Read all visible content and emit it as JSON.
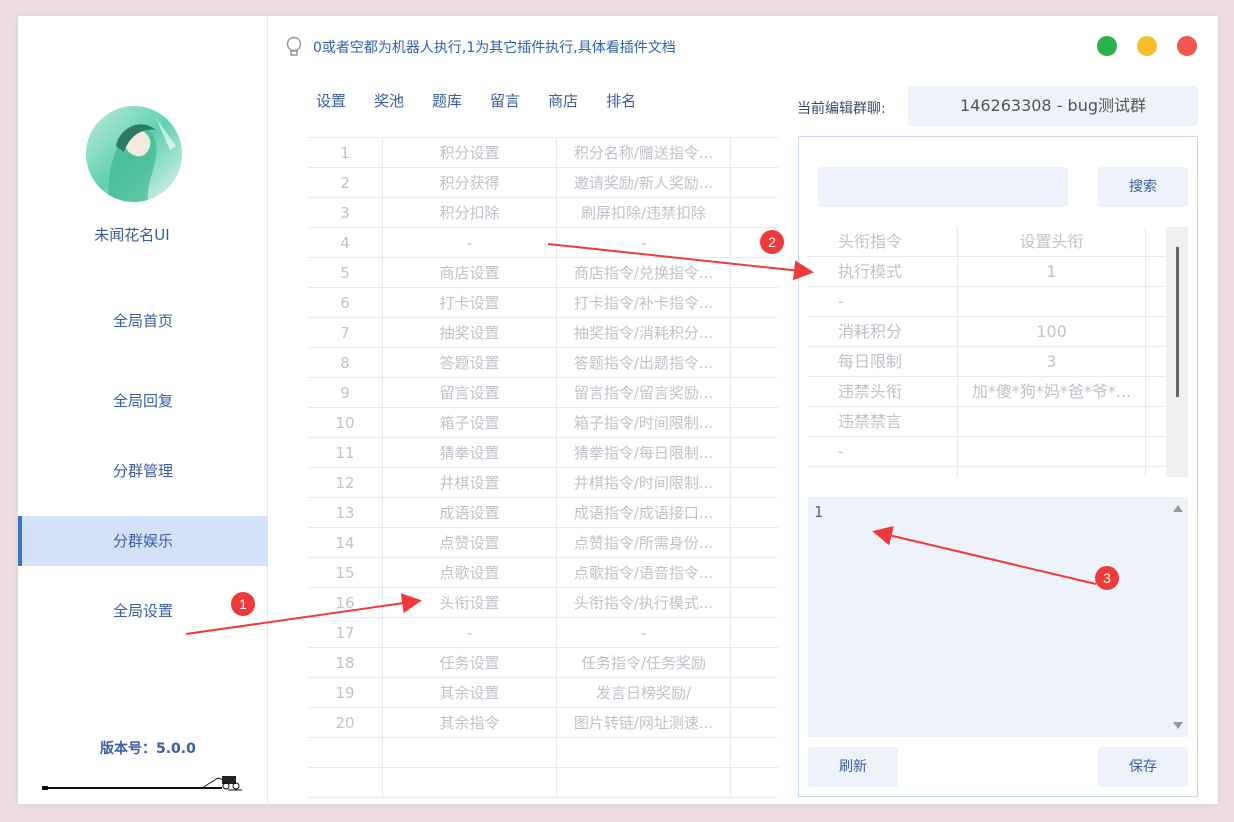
{
  "window": {
    "tip": "0或者空都为机器人执行,1为其它插件执行,具体看插件文档",
    "controls": {
      "green": "#2ab24b",
      "yellow": "#f7bf2c",
      "red": "#f2564f"
    }
  },
  "sidebar": {
    "username": "未闻花名UI",
    "items": [
      {
        "label": "全局首页"
      },
      {
        "label": "全局回复"
      },
      {
        "label": "分群管理"
      },
      {
        "label": "分群娱乐"
      },
      {
        "label": "全局设置"
      }
    ],
    "version": "版本号：5.0.0"
  },
  "tabs": [
    "设置",
    "奖池",
    "题库",
    "留言",
    "商店",
    "排名"
  ],
  "table": {
    "rows": [
      [
        "1",
        "积分设置",
        "积分名称/赠送指令..."
      ],
      [
        "2",
        "积分获得",
        "邀请奖励/新人奖励..."
      ],
      [
        "3",
        "积分扣除",
        "刷屏扣除/违禁扣除"
      ],
      [
        "4",
        "-",
        "-"
      ],
      [
        "5",
        "商店设置",
        "商店指令/兑换指令..."
      ],
      [
        "6",
        "打卡设置",
        "打卡指令/补卡指令..."
      ],
      [
        "7",
        "抽奖设置",
        "抽奖指令/消耗积分..."
      ],
      [
        "8",
        "答题设置",
        "答题指令/出题指令..."
      ],
      [
        "9",
        "留言设置",
        "留言指令/留言奖励..."
      ],
      [
        "10",
        "箱子设置",
        "箱子指令/时间限制..."
      ],
      [
        "11",
        "猜拳设置",
        "猜拳指令/每日限制..."
      ],
      [
        "12",
        "井棋设置",
        "井棋指令/时间限制..."
      ],
      [
        "13",
        "成语设置",
        "成语指令/成语接口..."
      ],
      [
        "14",
        "点赞设置",
        "点赞指令/所需身份..."
      ],
      [
        "15",
        "点歌设置",
        "点歌指令/语音指令..."
      ],
      [
        "16",
        "头衔设置",
        "头衔指令/执行模式..."
      ],
      [
        "17",
        "-",
        "-"
      ],
      [
        "18",
        "任务设置",
        "任务指令/任务奖励"
      ],
      [
        "19",
        "其余设置",
        "发言日榜奖励/"
      ],
      [
        "20",
        "其余指令",
        "图片转链/网址测速..."
      ],
      [
        "",
        "",
        ""
      ],
      [
        "",
        "",
        ""
      ]
    ]
  },
  "group": {
    "label": "当前编辑群聊:",
    "value": "146263308 - bug测试群"
  },
  "right": {
    "search_button": "搜索",
    "search_value": "",
    "rows": [
      [
        "头衔指令",
        "设置头衔"
      ],
      [
        "执行模式",
        "1"
      ],
      [
        "-",
        ""
      ],
      [
        "消耗积分",
        "100"
      ],
      [
        "每日限制",
        "3"
      ],
      [
        "违禁头衔",
        "加*傻*狗*妈*爸*爷*..."
      ],
      [
        "违禁禁言",
        ""
      ],
      [
        "-",
        ""
      ],
      [
        "",
        ""
      ]
    ],
    "editor_value": "1",
    "refresh_button": "刷新",
    "save_button": "保存"
  },
  "annotations": [
    "1",
    "2",
    "3"
  ]
}
